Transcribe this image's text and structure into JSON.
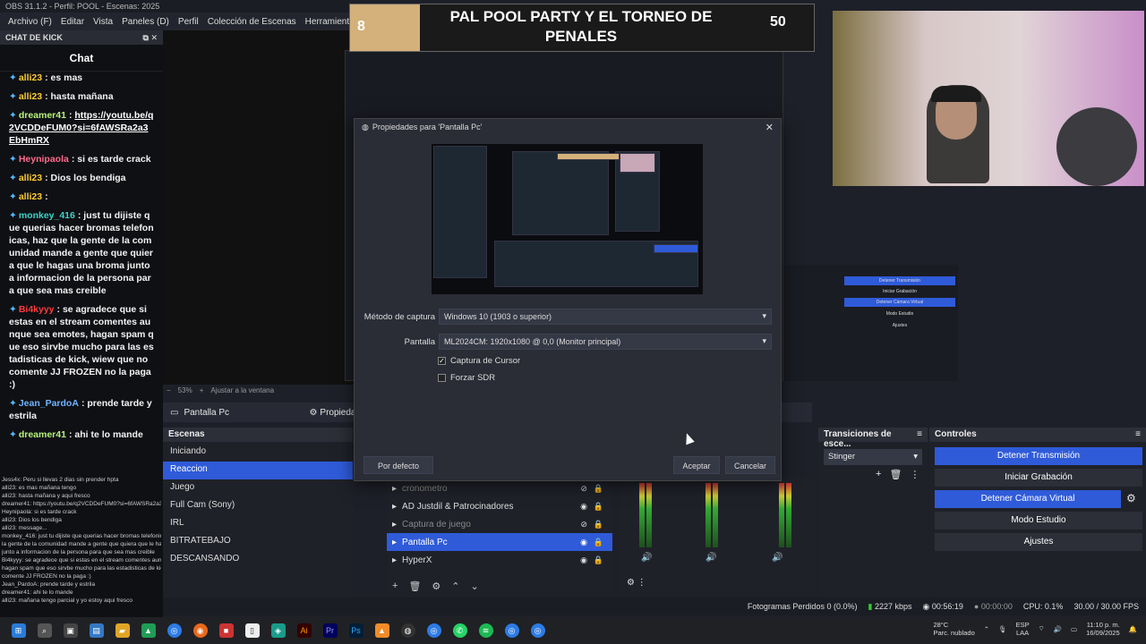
{
  "app": {
    "window_title": "OBS 31.1.2 - Perfil: POOL - Escenas: 2025"
  },
  "menu": [
    "Archivo (F)",
    "Editar",
    "Vista",
    "Paneles (D)",
    "Perfil",
    "Colección de Escenas",
    "Herramientas",
    "Ayuda"
  ],
  "chat": {
    "dock_title": "CHAT DE KICK",
    "header": "Chat",
    "messages": [
      {
        "user": "alli23",
        "text": "es mas",
        "user_color": "#ffcc33"
      },
      {
        "user": "alli23",
        "text": "hasta mañana",
        "user_color": "#ffcc33"
      },
      {
        "user": "dreamer41",
        "text": "https://youtu.be/q2VCDDeFUM0?si=6fAWSRa2a3EbHmRX",
        "user_color": "#b6f27a",
        "link": true
      },
      {
        "user": "Heynipaola",
        "text": "si es tarde crack",
        "user_color": "#ff6b8a"
      },
      {
        "user": "alli23",
        "text": "Dios los bendiga",
        "user_color": "#ffcc33"
      },
      {
        "user": "alli23",
        "text": "",
        "user_color": "#ffcc33"
      },
      {
        "user": "monkey_416",
        "text": "just tu dijiste que querias hacer bromas telefonicas, haz que la gente de la comunidad mande a gente que quiera que le hagas una broma junto a informacion de la persona para que sea mas creible",
        "user_color": "#3cd3c8"
      },
      {
        "user": "Bi4kyyy",
        "text": "se agradece que si estas en el stream comentes aunque sea emotes, hagan spam que eso sirvbe mucho para las estadisticas de kick, wiew que no comente JJ FROZEN no la paga :)",
        "user_color": "#ff3b3b"
      },
      {
        "user": "Jean_PardoA",
        "text": "prende tarde y estrila",
        "user_color": "#6fb4ff"
      },
      {
        "user": "dreamer41",
        "text": "ahi te lo mande",
        "user_color": "#b6f27a"
      }
    ],
    "mini_lines": [
      "Jess4x: Peru si llevas 2 dias sin prender hpta",
      "alli23: es mas   mañana tengo",
      "alli23: hasta mañana   y aqui fresco",
      "dreamer41: https://youtu.be/q2VCDDeFUM0?si=6fAWSRa2a3EbHmRX",
      "Heynipaola: si es tarde crack",
      "alli23: Dios los bendiga",
      "alli23:   message...",
      "monkey_416: just tu dijiste que querias hacer bromas telefonicas, haz que",
      "la gente de la comunidad mande a gente que quiera que le hagas una broma",
      "junto a informacion de la persona para que sea mas creible",
      "Bi4kyyy: se agradece que si estas en el stream comentes aunque sea emotes,",
      "hagan spam que eso sirvbe mucho para las estadisticas de kick, wiew que no",
      "comente JJ FROZEN no la paga :)",
      "Jean_PardoA: prende tarde y estrila",
      "dreamer41: ahi te lo mande",
      "alli23: mañana tengo parcial y yo estoy aqui fresco"
    ]
  },
  "overlay": {
    "score_left": "8",
    "title": "PAL POOL PARTY Y EL TORNEO DE PENALES",
    "score_right": "50"
  },
  "preview": {
    "zoom": "53%",
    "fit": "Ajustar a la ventana"
  },
  "source_bar": {
    "source": "Pantalla Pc",
    "properties": "Propiedades"
  },
  "scenes": {
    "title": "Escenas",
    "items": [
      "Iniciando",
      "Reaccion",
      "Juego",
      "Full Cam (Sony)",
      "IRL",
      "BITRATEBAJO",
      "DESCANSANDO"
    ],
    "selected": 1
  },
  "sources": {
    "items": [
      {
        "name": "cronometro",
        "visible": false
      },
      {
        "name": "AD Justdil & Patrocinadores",
        "visible": true
      },
      {
        "name": "Captura de juego",
        "visible": false
      },
      {
        "name": "Pantalla Pc",
        "visible": true
      },
      {
        "name": "HyperX",
        "visible": true
      }
    ],
    "selected": 3
  },
  "transitions": {
    "title": "Transiciones de esce...",
    "value": "Stinger"
  },
  "controls": {
    "title": "Controles",
    "buttons": [
      "Detener Transmisión",
      "Iniciar Grabación",
      "Detener Cámara Virtual",
      "Modo Estudio",
      "Ajustes"
    ]
  },
  "status": {
    "dropped": "Fotogramas Perdidos 0 (0.0%)",
    "bitrate": "2227 kbps",
    "stream_time": "00:56:19",
    "rec_time": "00:00:00",
    "cpu": "CPU: 0.1%",
    "fps": "30.00 / 30.00 FPS"
  },
  "tray": {
    "weather": "28°C",
    "weather_desc": "Parc. nublado",
    "lang": "ESP",
    "lang2": "LAA",
    "time": "11:10 p. m.",
    "date": "16/09/2025"
  },
  "dialog": {
    "title": "Propiedades para 'Pantalla Pc'",
    "capture_method_label": "Método de captura",
    "capture_method_value": "Windows 10 (1903 o superior)",
    "display_label": "Pantalla",
    "display_value": "ML2024CM: 1920x1080 @ 0,0 (Monitor principal)",
    "cursor_label": "Captura de Cursor",
    "cursor_checked": true,
    "sdr_label": "Forzar SDR",
    "sdr_checked": false,
    "defaults_btn": "Por defecto",
    "ok_btn": "Aceptar",
    "cancel_btn": "Cancelar"
  },
  "colors": {
    "accent": "#2f5bd9",
    "panel": "#1f2129",
    "dialog": "#2a2c36"
  }
}
